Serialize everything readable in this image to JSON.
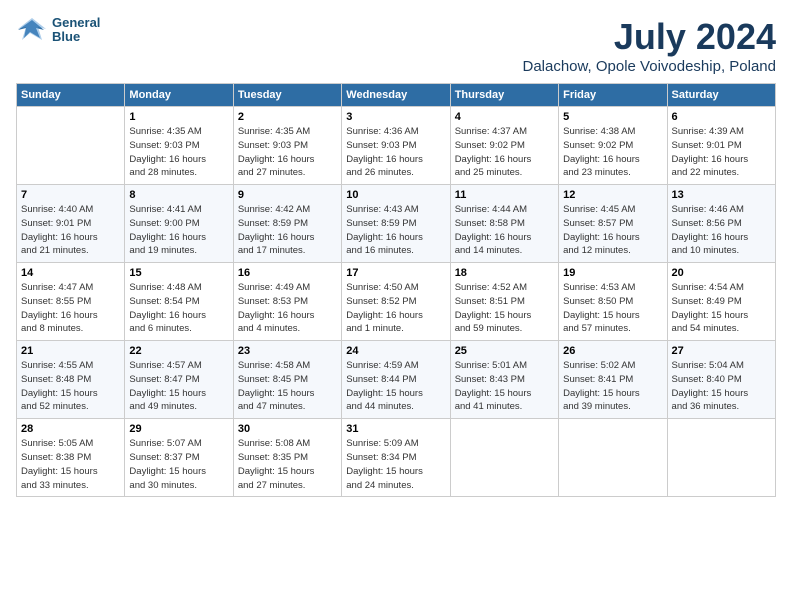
{
  "header": {
    "logo_line1": "General",
    "logo_line2": "Blue",
    "month_year": "July 2024",
    "location": "Dalachow, Opole Voivodeship, Poland"
  },
  "weekdays": [
    "Sunday",
    "Monday",
    "Tuesday",
    "Wednesday",
    "Thursday",
    "Friday",
    "Saturday"
  ],
  "weeks": [
    [
      {
        "day": "",
        "detail": ""
      },
      {
        "day": "1",
        "detail": "Sunrise: 4:35 AM\nSunset: 9:03 PM\nDaylight: 16 hours\nand 28 minutes."
      },
      {
        "day": "2",
        "detail": "Sunrise: 4:35 AM\nSunset: 9:03 PM\nDaylight: 16 hours\nand 27 minutes."
      },
      {
        "day": "3",
        "detail": "Sunrise: 4:36 AM\nSunset: 9:03 PM\nDaylight: 16 hours\nand 26 minutes."
      },
      {
        "day": "4",
        "detail": "Sunrise: 4:37 AM\nSunset: 9:02 PM\nDaylight: 16 hours\nand 25 minutes."
      },
      {
        "day": "5",
        "detail": "Sunrise: 4:38 AM\nSunset: 9:02 PM\nDaylight: 16 hours\nand 23 minutes."
      },
      {
        "day": "6",
        "detail": "Sunrise: 4:39 AM\nSunset: 9:01 PM\nDaylight: 16 hours\nand 22 minutes."
      }
    ],
    [
      {
        "day": "7",
        "detail": "Sunrise: 4:40 AM\nSunset: 9:01 PM\nDaylight: 16 hours\nand 21 minutes."
      },
      {
        "day": "8",
        "detail": "Sunrise: 4:41 AM\nSunset: 9:00 PM\nDaylight: 16 hours\nand 19 minutes."
      },
      {
        "day": "9",
        "detail": "Sunrise: 4:42 AM\nSunset: 8:59 PM\nDaylight: 16 hours\nand 17 minutes."
      },
      {
        "day": "10",
        "detail": "Sunrise: 4:43 AM\nSunset: 8:59 PM\nDaylight: 16 hours\nand 16 minutes."
      },
      {
        "day": "11",
        "detail": "Sunrise: 4:44 AM\nSunset: 8:58 PM\nDaylight: 16 hours\nand 14 minutes."
      },
      {
        "day": "12",
        "detail": "Sunrise: 4:45 AM\nSunset: 8:57 PM\nDaylight: 16 hours\nand 12 minutes."
      },
      {
        "day": "13",
        "detail": "Sunrise: 4:46 AM\nSunset: 8:56 PM\nDaylight: 16 hours\nand 10 minutes."
      }
    ],
    [
      {
        "day": "14",
        "detail": "Sunrise: 4:47 AM\nSunset: 8:55 PM\nDaylight: 16 hours\nand 8 minutes."
      },
      {
        "day": "15",
        "detail": "Sunrise: 4:48 AM\nSunset: 8:54 PM\nDaylight: 16 hours\nand 6 minutes."
      },
      {
        "day": "16",
        "detail": "Sunrise: 4:49 AM\nSunset: 8:53 PM\nDaylight: 16 hours\nand 4 minutes."
      },
      {
        "day": "17",
        "detail": "Sunrise: 4:50 AM\nSunset: 8:52 PM\nDaylight: 16 hours\nand 1 minute."
      },
      {
        "day": "18",
        "detail": "Sunrise: 4:52 AM\nSunset: 8:51 PM\nDaylight: 15 hours\nand 59 minutes."
      },
      {
        "day": "19",
        "detail": "Sunrise: 4:53 AM\nSunset: 8:50 PM\nDaylight: 15 hours\nand 57 minutes."
      },
      {
        "day": "20",
        "detail": "Sunrise: 4:54 AM\nSunset: 8:49 PM\nDaylight: 15 hours\nand 54 minutes."
      }
    ],
    [
      {
        "day": "21",
        "detail": "Sunrise: 4:55 AM\nSunset: 8:48 PM\nDaylight: 15 hours\nand 52 minutes."
      },
      {
        "day": "22",
        "detail": "Sunrise: 4:57 AM\nSunset: 8:47 PM\nDaylight: 15 hours\nand 49 minutes."
      },
      {
        "day": "23",
        "detail": "Sunrise: 4:58 AM\nSunset: 8:45 PM\nDaylight: 15 hours\nand 47 minutes."
      },
      {
        "day": "24",
        "detail": "Sunrise: 4:59 AM\nSunset: 8:44 PM\nDaylight: 15 hours\nand 44 minutes."
      },
      {
        "day": "25",
        "detail": "Sunrise: 5:01 AM\nSunset: 8:43 PM\nDaylight: 15 hours\nand 41 minutes."
      },
      {
        "day": "26",
        "detail": "Sunrise: 5:02 AM\nSunset: 8:41 PM\nDaylight: 15 hours\nand 39 minutes."
      },
      {
        "day": "27",
        "detail": "Sunrise: 5:04 AM\nSunset: 8:40 PM\nDaylight: 15 hours\nand 36 minutes."
      }
    ],
    [
      {
        "day": "28",
        "detail": "Sunrise: 5:05 AM\nSunset: 8:38 PM\nDaylight: 15 hours\nand 33 minutes."
      },
      {
        "day": "29",
        "detail": "Sunrise: 5:07 AM\nSunset: 8:37 PM\nDaylight: 15 hours\nand 30 minutes."
      },
      {
        "day": "30",
        "detail": "Sunrise: 5:08 AM\nSunset: 8:35 PM\nDaylight: 15 hours\nand 27 minutes."
      },
      {
        "day": "31",
        "detail": "Sunrise: 5:09 AM\nSunset: 8:34 PM\nDaylight: 15 hours\nand 24 minutes."
      },
      {
        "day": "",
        "detail": ""
      },
      {
        "day": "",
        "detail": ""
      },
      {
        "day": "",
        "detail": ""
      }
    ]
  ]
}
